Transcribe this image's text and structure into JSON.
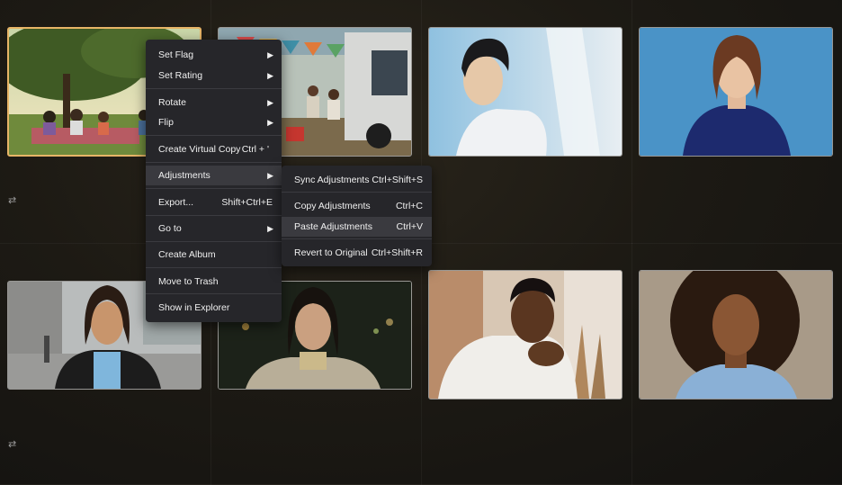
{
  "context_menu": {
    "items": [
      {
        "label": "Set Flag",
        "shortcut": "",
        "submenu": true
      },
      {
        "label": "Set Rating",
        "shortcut": "",
        "submenu": true
      },
      {
        "label": "Rotate",
        "shortcut": "",
        "submenu": true
      },
      {
        "label": "Flip",
        "shortcut": "",
        "submenu": true
      },
      {
        "label": "Create Virtual Copy",
        "shortcut": "Ctrl + '",
        "submenu": false
      },
      {
        "label": "Adjustments",
        "shortcut": "",
        "submenu": true
      },
      {
        "label": "Export...",
        "shortcut": "Shift+Ctrl+E",
        "submenu": false
      },
      {
        "label": "Go to",
        "shortcut": "",
        "submenu": true
      },
      {
        "label": "Create Album",
        "shortcut": "",
        "submenu": false
      },
      {
        "label": "Move to Trash",
        "shortcut": "",
        "submenu": false
      },
      {
        "label": "Show in Explorer",
        "shortcut": "",
        "submenu": false
      }
    ]
  },
  "submenu": {
    "items": [
      {
        "label": "Sync Adjustments",
        "shortcut": "Ctrl+Shift+S"
      },
      {
        "label": "Copy Adjustments",
        "shortcut": "Ctrl+C"
      },
      {
        "label": "Paste Adjustments",
        "shortcut": "Ctrl+V"
      },
      {
        "label": "Revert to Original",
        "shortcut": "Ctrl+Shift+R"
      }
    ]
  },
  "arrow_glyph": "▶",
  "adjust_icon_glyph": "⇄",
  "colors": {
    "selection_border": "#e7b567",
    "menu_bg": "#26262a",
    "menu_highlight": "#3a3a3f"
  }
}
